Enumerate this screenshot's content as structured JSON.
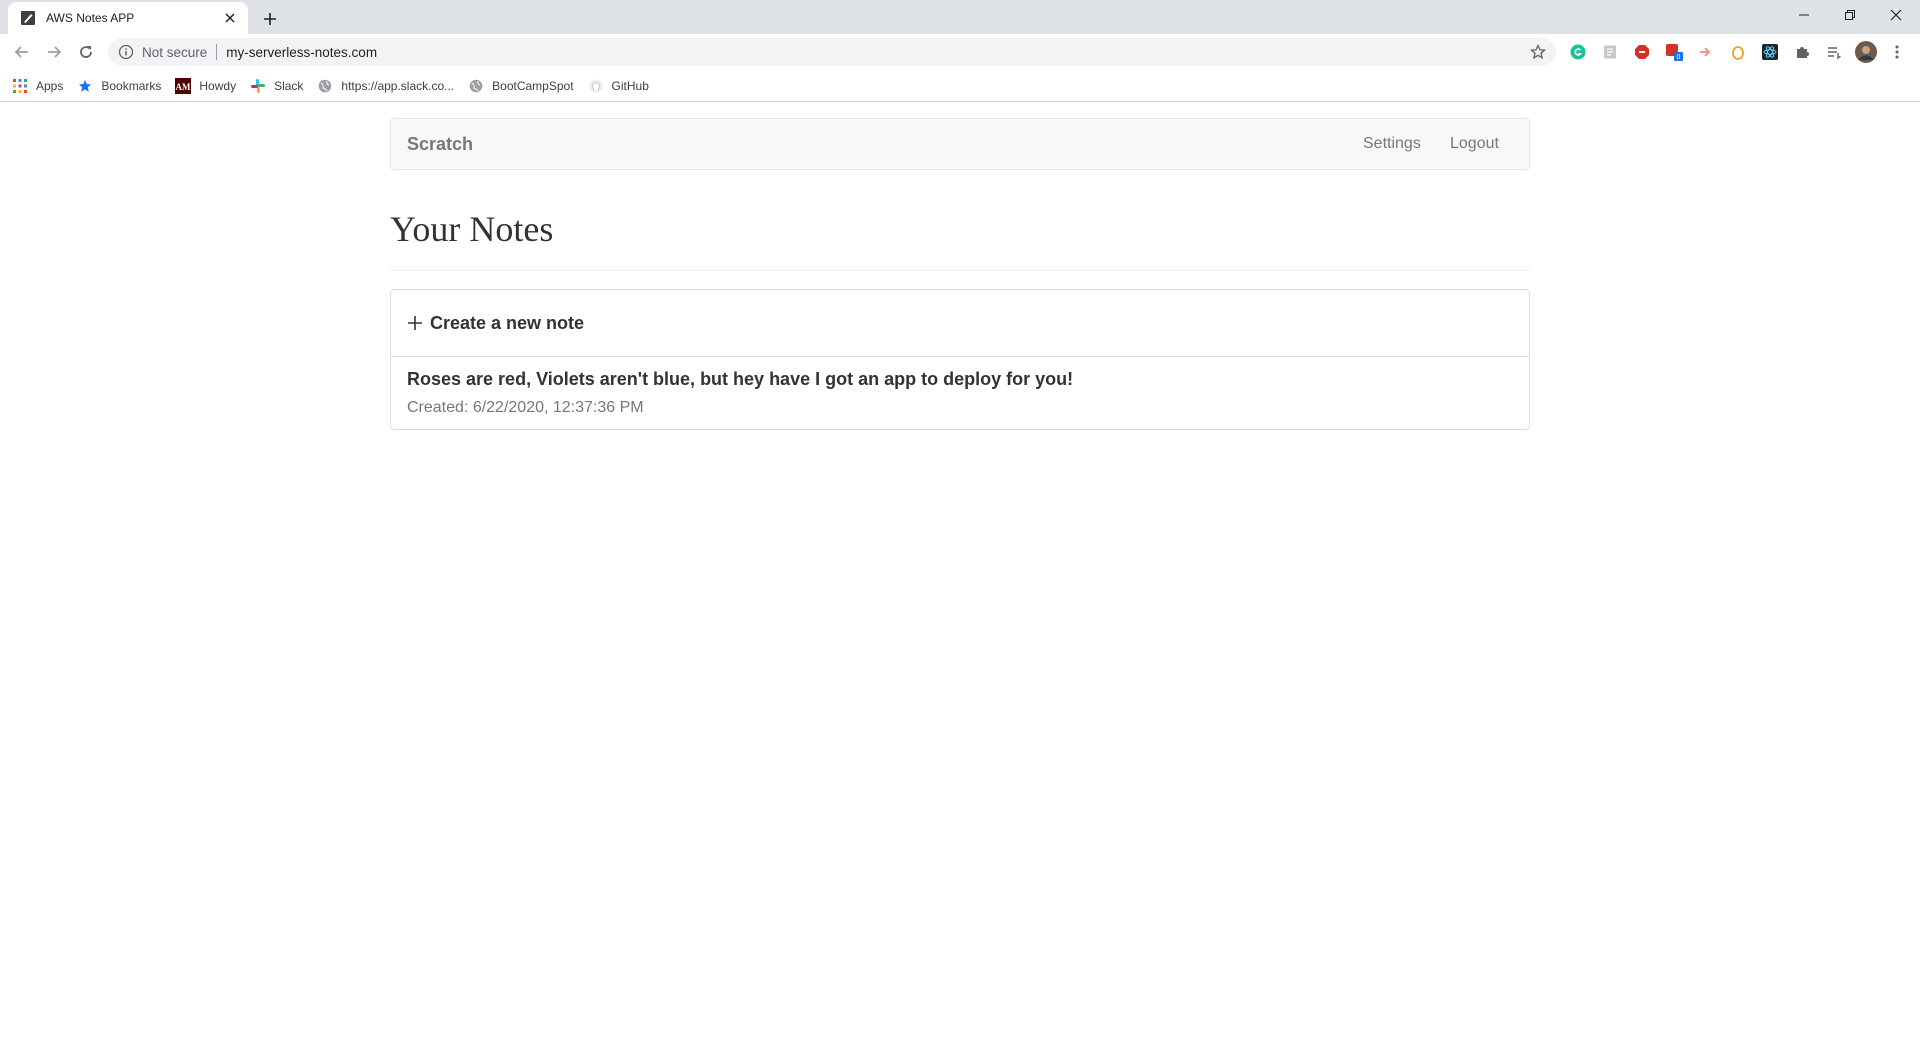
{
  "browser": {
    "tab_title": "AWS Notes APP",
    "security_text": "Not secure",
    "url": "my-serverless-notes.com",
    "bookmarks": [
      {
        "label": "Apps",
        "icon": "apps-grid-icon"
      },
      {
        "label": "Bookmarks",
        "icon": "star-icon"
      },
      {
        "label": "Howdy",
        "icon": "howdy-icon"
      },
      {
        "label": "Slack",
        "icon": "slack-icon"
      },
      {
        "label": "https://app.slack.co...",
        "icon": "globe-icon"
      },
      {
        "label": "BootCampSpot",
        "icon": "globe-icon"
      },
      {
        "label": "GitHub",
        "icon": "github-icon"
      }
    ]
  },
  "app": {
    "brand": "Scratch",
    "nav": {
      "settings": "Settings",
      "logout": "Logout"
    },
    "page_title": "Your Notes",
    "create_label": "Create a new note",
    "notes": [
      {
        "title": "Roses are red, Violets aren't blue, but hey have I got an app to deploy for you!",
        "created": "Created: 6/22/2020, 12:37:36 PM"
      }
    ]
  },
  "colors": {
    "navbar_bg": "#f8f8f8",
    "muted_text": "#777777",
    "body_text": "#333333",
    "border": "#dddddd"
  }
}
